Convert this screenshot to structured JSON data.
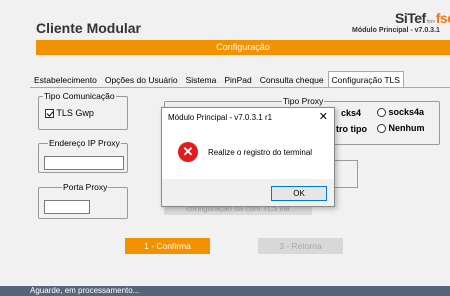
{
  "app": {
    "title": "Cliente Modular",
    "logo_main": "SiTef",
    "logo_from": "from",
    "logo_brand": "fse",
    "version": "Módulo Principal - v7.0.3.1"
  },
  "banner": {
    "title": "Configuração"
  },
  "tabs": [
    {
      "label": "Estabelecimento"
    },
    {
      "label": "Opções do Usuário"
    },
    {
      "label": "Sistema"
    },
    {
      "label": "PinPad"
    },
    {
      "label": "Consulta cheque"
    },
    {
      "label": "Configuração TLS"
    }
  ],
  "panel": {
    "tipo_comunicacao": {
      "legend": "Tipo Comunicação",
      "option": "TLS Gwp",
      "checked": true
    },
    "tipo_proxy": {
      "legend": "Tipo Proxy",
      "opt_socks4_partial": "cks4",
      "opt_socks4a": "socks4a",
      "opt_outro_partial": "tro tipo",
      "opt_nenhum": "Nenhum"
    },
    "endereco_ip_proxy": {
      "legend": "Endereço IP Proxy",
      "value": ""
    },
    "porta_proxy": {
      "legend": "Porta Proxy",
      "value": ""
    },
    "configure_btn_partial": "configuração da com TLS via"
  },
  "buttons": {
    "confirm": "1 - Confirma",
    "return": "3 - Retorna"
  },
  "status": {
    "text": "Aguarde, em processamento..."
  },
  "dialog": {
    "title": "Módulo Principal - v7.0.3.1 r1",
    "close": "✕",
    "icon": "error-icon",
    "message": "Realize o registro do terminal",
    "ok": "OK"
  },
  "colors": {
    "accent": "#f29200",
    "status_bg": "#55657a",
    "error": "#e21b1b"
  }
}
